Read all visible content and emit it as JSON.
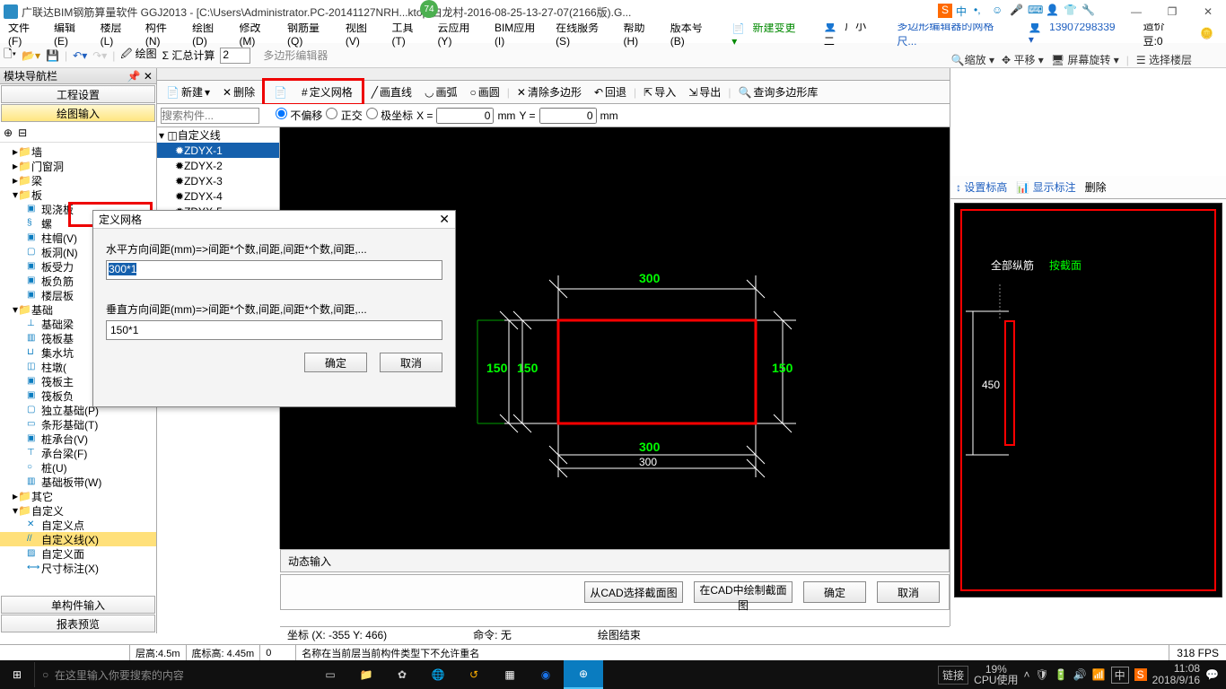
{
  "title": "广联达BIM钢筋算量软件 GGJ2013 - [C:\\Users\\Administrator.PC-20141127NRH...ktop\\白龙村-2016-08-25-13-27-07(2166版).G...",
  "menubar": [
    "文件(F)",
    "编辑(E)",
    "楼层(L)",
    "构件(N)",
    "绘图(D)",
    "修改(M)",
    "钢筋量(Q)",
    "视图(V)",
    "工具(T)",
    "云应用(Y)",
    "BIM应用(I)",
    "在线服务(S)",
    "帮助(H)",
    "版本号(B)"
  ],
  "menubar_right": {
    "newchange": "新建变更",
    "user": "广小二",
    "polyedit": "多边形编辑器的网格尺...",
    "phone": "13907298339",
    "zaodou": "造价豆:0"
  },
  "toolbar1": {
    "draw": "绘图",
    "sum": "汇总计算",
    "spin": "2",
    "hint": "多边形编辑器"
  },
  "right_dd": {
    "zoom": "缩放",
    "pan": "平移",
    "screenrot": "屏幕旋转",
    "floor": "选择楼层"
  },
  "toolbar2": {
    "new": "新建",
    "del": "删除",
    "defgrid": "定义网格",
    "line": "画直线",
    "arc": "画弧",
    "circle": "画圆",
    "clear": "清除多边形",
    "back": "回退",
    "import": "导入",
    "export": "导出",
    "querylib": "查询多边形库"
  },
  "coordbar": {
    "noshift": "不偏移",
    "ortho": "正交",
    "polar": "极坐标",
    "x": "X =",
    "xval": "0",
    "mm": "mm",
    "y": "Y =",
    "yval": "0"
  },
  "left": {
    "title": "模块导航栏",
    "tab1": "工程设置",
    "tab2": "绘图输入",
    "tree": {
      "qiang": "墙",
      "menchuan": "门窗洞",
      "liang": "梁",
      "ban": "板",
      "xjb": "现浇板",
      "sqk": "螺",
      "zhumao": "柱帽(V)",
      "bandong": "板洞(N)",
      "banshouli": "板受力",
      "banfujin": "板负筋",
      "loucengb": "楼层板",
      "jichu": "基础",
      "jichuliang": "基础梁",
      "fabanji": "筏板基",
      "jishuikeng": "集水坑",
      "zhudun": "柱墩(",
      "faban": "筏板主",
      "fabanfu": "筏板负",
      "dljc": "独立基础(P)",
      "txjc": "条形基础(T)",
      "zhuangcheng": "桩承台(V)",
      "chengtailiang": "承台梁(F)",
      "zhuang": "桩(U)",
      "jichubandai": "基础板带(W)",
      "qita": "其它",
      "zidingyi": "自定义",
      "zdydian": "自定义点",
      "zdyxian": "自定义线(X)",
      "zdymian": "自定义面",
      "chicun": "尺寸标注(X)"
    },
    "bot1": "单构件输入",
    "bot2": "报表预览"
  },
  "sidetree": {
    "search": "搜索构件...",
    "root": "自定义线",
    "items": [
      "ZDYX-1",
      "ZDYX-2",
      "ZDYX-3",
      "ZDYX-4",
      "ZDYX-5"
    ]
  },
  "canvas": {
    "d300": "300",
    "d150": "150",
    "d150b": "150",
    "d300b": "300",
    "d300c": "300"
  },
  "dyn": "动态输入",
  "btm": {
    "cad1": "从CAD选择截面图",
    "cad2": "在CAD中绘制截面图",
    "ok": "确定",
    "cancel": "取消"
  },
  "status": {
    "coord": "坐标 (X: -355 Y: 466)",
    "cmd": "命令: 无",
    "drawend": "绘图结束"
  },
  "status2": {
    "ch": "层高:4.5m",
    "dbg": "底标高: 4.45m",
    "zero": "0",
    "warn": "名称在当前层当前构件类型下不允许重名",
    "fps": "318 FPS"
  },
  "rp": {
    "setel": "设置标高",
    "showlabel": "显示标注",
    "del": "删除",
    "alljin": "全部纵筋",
    "byjie": "按截面",
    "d450": "450"
  },
  "dialog": {
    "title": "定义网格",
    "h_lbl": "水平方向间距(mm)=>间距*个数,间距,间距*个数,间距,...",
    "h_val": "300*1",
    "v_lbl": "垂直方向间距(mm)=>间距*个数,间距,间距*个数,间距,...",
    "v_val": "150*1",
    "ok": "确定",
    "cancel": "取消"
  },
  "taskbar": {
    "search": "在这里输入你要搜索的内容",
    "link": "链接",
    "cpu": "19%",
    "cpulab": "CPU使用",
    "ime": "中",
    "time": "11:08",
    "date": "2018/9/16"
  }
}
